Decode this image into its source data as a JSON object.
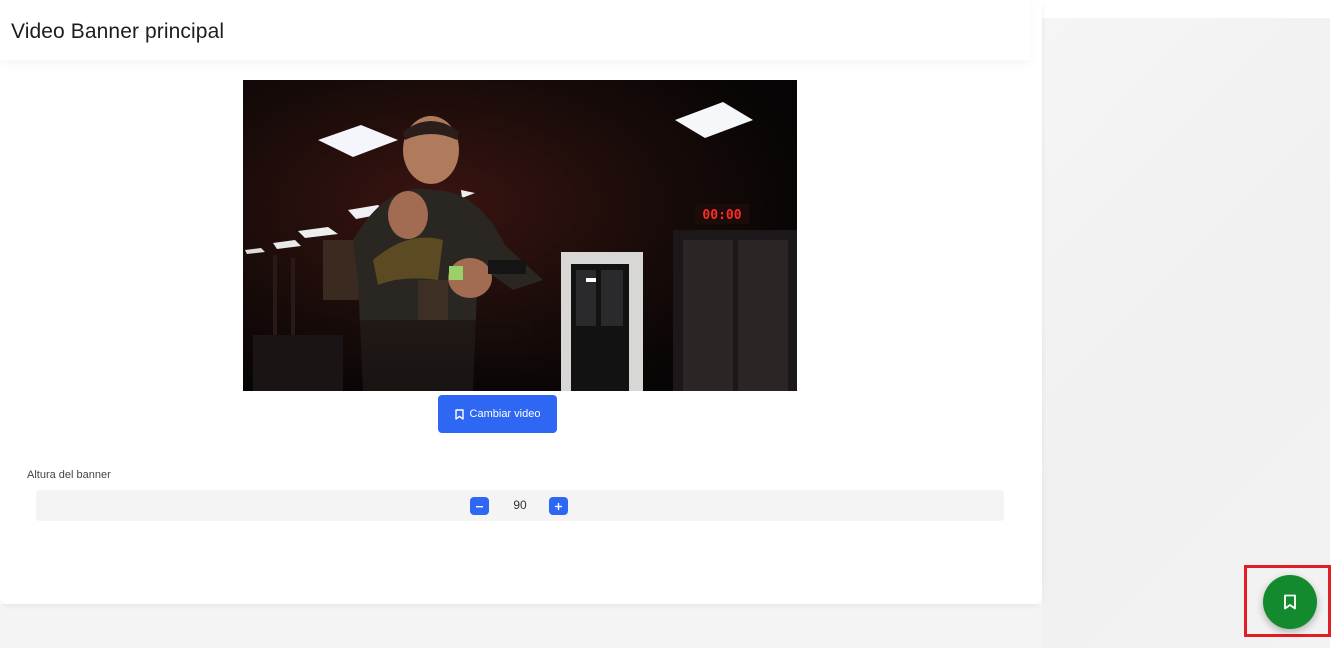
{
  "card": {
    "title": "Video Banner principal"
  },
  "video": {
    "change_button_label": "Cambiar video",
    "change_button_icon": "bookmark-icon",
    "clock_text": "00:00"
  },
  "banner_height": {
    "label": "Altura del banner",
    "value": "90",
    "decrement_icon": "minus-icon",
    "increment_icon": "plus-icon"
  },
  "save_fab": {
    "icon": "bookmark-icon"
  },
  "colors": {
    "primary_blue": "#2d67f4",
    "save_green": "#148a2f",
    "highlight_red": "#e11d25"
  }
}
